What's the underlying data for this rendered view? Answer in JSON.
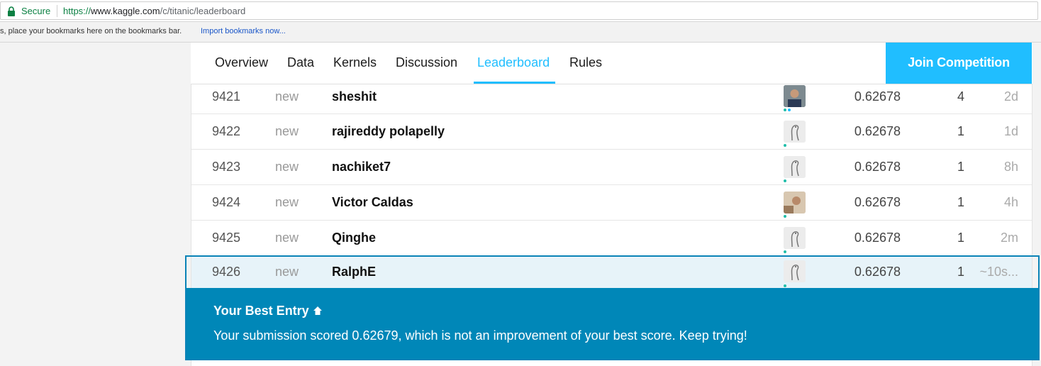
{
  "browser": {
    "secure_label": "Secure",
    "url_scheme": "https://",
    "url_host": "www.kaggle.com",
    "url_path": "/c/titanic/leaderboard",
    "bookmarks_text": "s, place your bookmarks here on the bookmarks bar.",
    "bookmarks_link": "Import bookmarks now..."
  },
  "nav": {
    "tabs": [
      {
        "label": "Overview"
      },
      {
        "label": "Data"
      },
      {
        "label": "Kernels"
      },
      {
        "label": "Discussion"
      },
      {
        "label": "Leaderboard",
        "active": true
      },
      {
        "label": "Rules"
      }
    ],
    "join_label": "Join Competition"
  },
  "leaderboard": {
    "rows": [
      {
        "rank": "9421",
        "change": "new",
        "team": "sheshit",
        "avatar": "photo-person-icon",
        "score": "0.62678",
        "entries": "4",
        "last": "2d"
      },
      {
        "rank": "9422",
        "change": "new",
        "team": "rajireddy polapelly",
        "avatar": "default-ostrich-avatar-icon",
        "score": "0.62678",
        "entries": "1",
        "last": "1d"
      },
      {
        "rank": "9423",
        "change": "new",
        "team": "nachiket7",
        "avatar": "default-ostrich-avatar-icon",
        "score": "0.62678",
        "entries": "1",
        "last": "8h"
      },
      {
        "rank": "9424",
        "change": "new",
        "team": "Victor Caldas",
        "avatar": "photo-person-icon",
        "score": "0.62678",
        "entries": "1",
        "last": "4h"
      },
      {
        "rank": "9425",
        "change": "new",
        "team": "Qinghe",
        "avatar": "default-ostrich-avatar-icon",
        "score": "0.62678",
        "entries": "1",
        "last": "2m"
      },
      {
        "rank": "9426",
        "change": "new",
        "team": "RalphE",
        "avatar": "default-ostrich-avatar-icon",
        "score": "0.62678",
        "entries": "1",
        "last": "~10s...",
        "highlight": true
      }
    ]
  },
  "best_entry": {
    "title": "Your Best Entry",
    "message": "Your submission scored 0.62679, which is not an improvement of your best score. Keep trying!"
  },
  "colors": {
    "accent": "#20beff",
    "best_box": "#0087b8",
    "highlight_row": "#e7f3f9"
  }
}
